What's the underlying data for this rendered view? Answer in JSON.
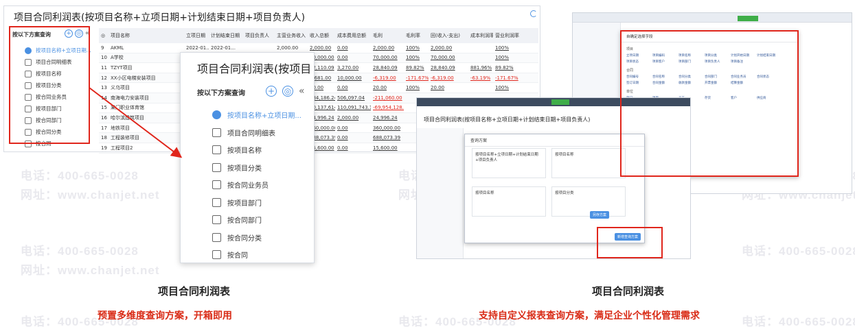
{
  "watermark": {
    "phone": "电话：400-665-0028",
    "site": "网址：www.chanjet.net"
  },
  "left_screenshot": {
    "title": "项目合同利润表(按项目名称+立项日期+计划结束日期+项目负责人)",
    "sidebar": {
      "heading": "按以下方案查询",
      "add_icon": "+",
      "collapse_icon": "«",
      "items": [
        "按项目名称+立项日期...",
        "项目合同明细表",
        "按项目名称",
        "按项目分类",
        "按合同业务员",
        "按项目部门",
        "按合同部门",
        "按合同分类",
        "按合同"
      ]
    },
    "table": {
      "headers": [
        "◎",
        "项目名称",
        "立项日期",
        "计划结束日期",
        "项目负责人",
        "主营业务收入",
        "收入总额",
        "成本费用总额",
        "毛利",
        "毛利率",
        "回(收入-支出)",
        "成本利润率",
        "营业利润率"
      ],
      "rows": [
        [
          "9",
          "AKML",
          "2022-01...",
          "2022-01...",
          "",
          "2,000.00",
          "2,000.00",
          "0.00",
          "2,000.00",
          "100%",
          "2,000.00",
          "",
          "100%"
        ],
        [
          "10",
          "A学校",
          "",
          "",
          "",
          "",
          "70,000.00",
          "0.00",
          "70,000.00",
          "100%",
          "70,000.00",
          "",
          "100%"
        ],
        [
          "11",
          "TZYT项目",
          "",
          "",
          "",
          "",
          "32,110.09",
          "3,270.00",
          "28,840.09",
          "89.82%",
          "28,840.09",
          "881.96%",
          "89.82%"
        ],
        [
          "12",
          "XX小区电梯安装项目",
          "",
          "",
          "",
          "",
          "3,681.00",
          "10,000.00",
          "-6,319.00",
          "-171.67%",
          "-6,319.00",
          "-63.19%",
          "-171.67%"
        ],
        [
          "13",
          "义乌项目",
          "",
          "",
          "",
          "",
          "20.00",
          "0.00",
          "20.00",
          "100%",
          "20.00",
          "",
          "100%"
        ],
        [
          "14",
          "南海电力安装项目",
          "",
          "",
          "",
          "",
          "184,186.24",
          "506,097.04",
          "-211,060.00",
          "",
          "",
          "",
          ""
        ],
        [
          "15",
          "某门职业体育馆",
          "",
          "",
          "",
          "",
          "40,137,614.6",
          "110,091,743.1",
          "-69,954,128.4",
          "",
          "",
          "",
          ""
        ],
        [
          "16",
          "哈尔滨建筑项目",
          "",
          "",
          "",
          "",
          "24,996.24",
          "2,000.00",
          "24,996.24",
          "",
          "",
          "",
          ""
        ],
        [
          "17",
          "地铁项目",
          "",
          "",
          "",
          "",
          "360,000.00",
          "0.00",
          "360,000.00",
          "",
          "",
          "",
          ""
        ],
        [
          "18",
          "工程装修项目",
          "",
          "",
          "",
          "",
          "688,073.39",
          "0.00",
          "688,073.39",
          "",
          "",
          "",
          ""
        ],
        [
          "19",
          "工程项目2",
          "",
          "",
          "",
          "",
          "15,600.00",
          "0.00",
          "15,600.00",
          "",
          "",
          "",
          ""
        ]
      ]
    }
  },
  "zoom_popup": {
    "title": "项目合同利润表(按项目",
    "heading": "按以下方案查询",
    "items": [
      "按项目名称+立项日期...",
      "项目合同明细表",
      "按项目名称",
      "按项目分类",
      "按合同业务员",
      "按项目部门",
      "按合同部门",
      "按合同分类",
      "按合同"
    ]
  },
  "right_screenshot": {
    "front_title": "项目合同利润表(按项目名称+立项日期+计划结束日期+项目负责人)",
    "modal_title": "查询方案",
    "cards": [
      "按项目名称+立项日期+计划结束日期+项目负责人",
      "按项目名称",
      "按项目名称",
      "按项目分类"
    ],
    "card_actions": [
      "编辑",
      "删除",
      "另存方案"
    ],
    "add_button": "新增查询方案",
    "dialog_title": "自确定选择字段",
    "dialog_sections": [
      "项目",
      "合同",
      "单位"
    ],
    "dialog_fields": [
      "立项日期",
      "项目编码",
      "项目名称",
      "项目分类",
      "计划开始日期",
      "计划结束日期",
      "项目状态",
      "项目客户",
      "项目部门",
      "项目负责人",
      "项目备注",
      "合同编号",
      "合同名称",
      "合同分类",
      "合同部门",
      "合同业务员",
      "合同状态",
      "签订日期",
      "合同金额",
      "收款金额",
      "开票金额",
      "结算金额",
      "部门",
      "项目",
      "员工",
      "存货",
      "客户",
      "供应商",
      "地区",
      "行业"
    ]
  },
  "captions": {
    "left_title": "项目合同利润表",
    "left_sub": "预置多维度查询方案，开箱即用",
    "right_title": "项目合同利润表",
    "right_sub": "支持自定义报表查询方案，满足企业个性化管理需求"
  }
}
